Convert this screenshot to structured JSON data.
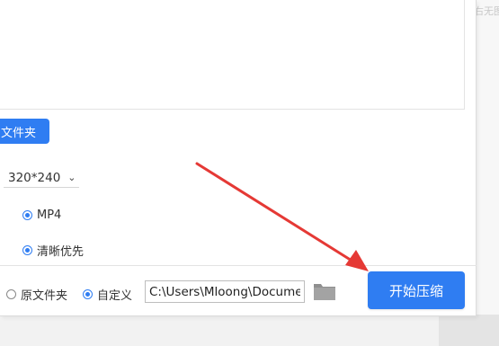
{
  "corner_text": "右无图",
  "folder_button_label": "文件夹",
  "resolution": {
    "value": "320*240",
    "chevron": "chevron-down-icon"
  },
  "format": {
    "label": "MP4",
    "checked": true
  },
  "quality": {
    "label": "清晰优先",
    "checked": true
  },
  "output": {
    "original_label": "原文件夹",
    "custom_label": "自定义",
    "path_value": "C:\\Users\\Mloong\\Documents",
    "folder_icon": "folder-icon"
  },
  "start_button_label": "开始压缩",
  "colors": {
    "accent": "#2f7df2",
    "arrow": "#e53935"
  }
}
